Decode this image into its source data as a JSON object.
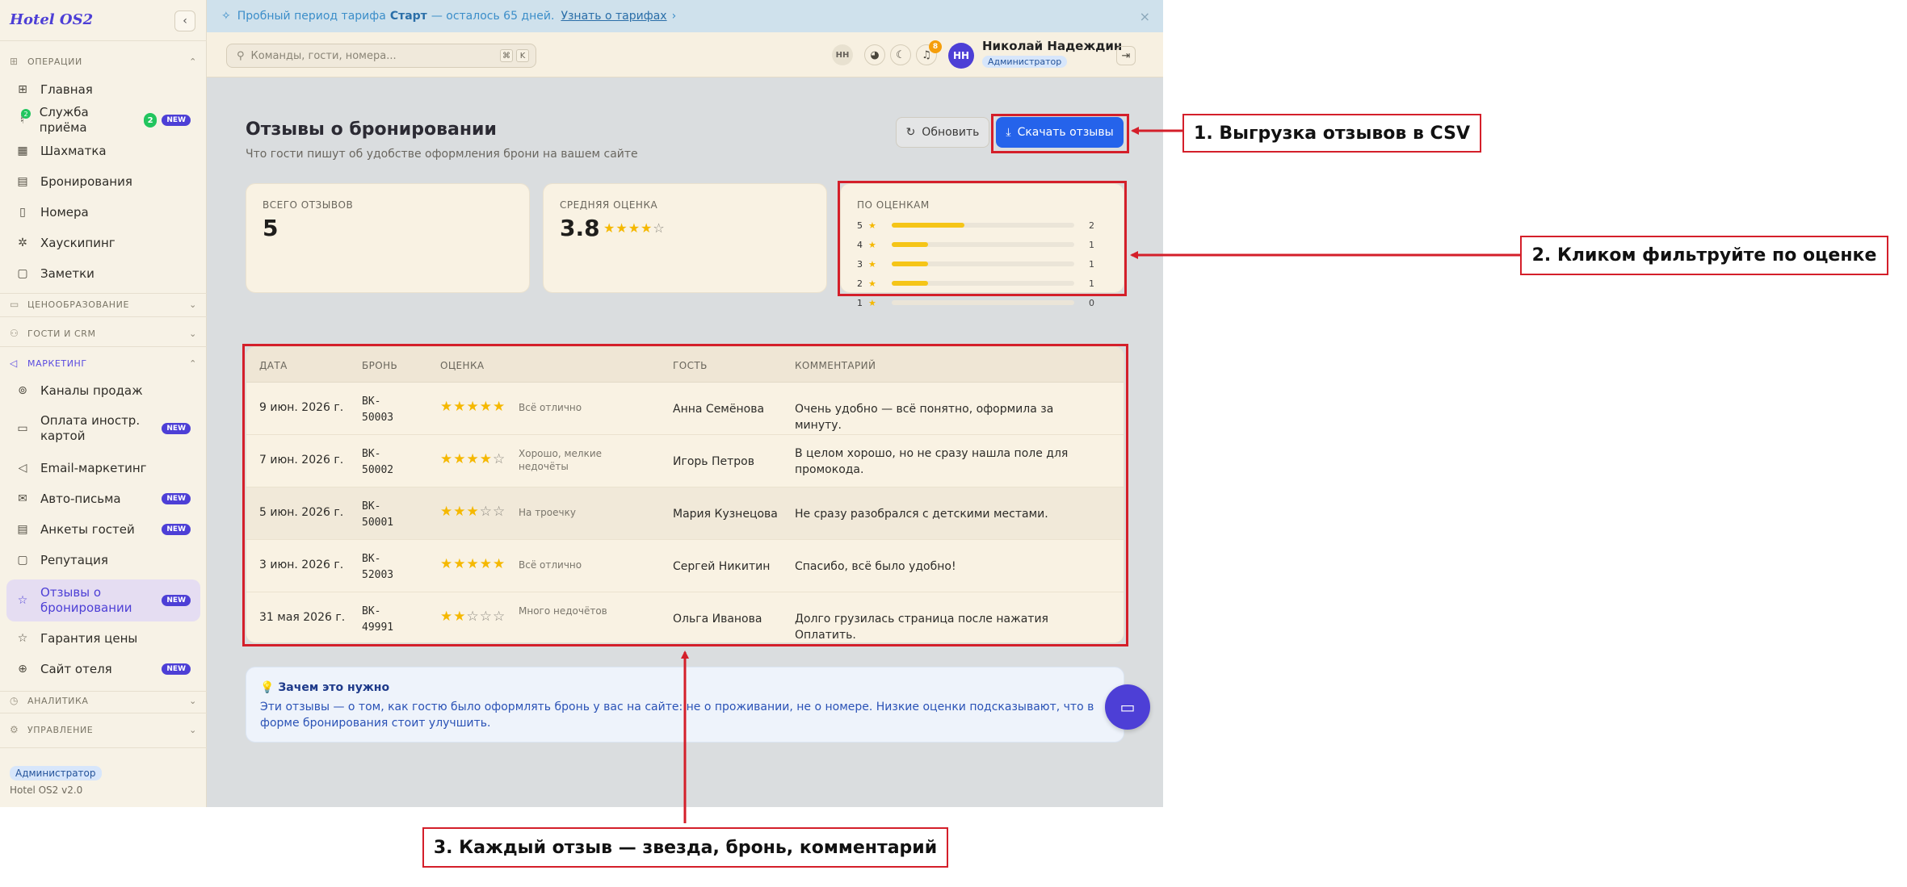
{
  "app": {
    "brand": "Hotel OS2",
    "version": "Hotel OS2 v2.0",
    "role_badge": "Администратор"
  },
  "banner": {
    "text_before": "Пробный период тарифа",
    "plan": "Старт",
    "text_after": "— осталось 65 дней.",
    "link": "Узнать о тарифах"
  },
  "sidebar": {
    "sections": [
      {
        "label": "Операции",
        "expanded": true
      },
      {
        "label": "Ценообразование",
        "expanded": false
      },
      {
        "label": "Гости и CRM",
        "expanded": false
      },
      {
        "label": "Маркетинг",
        "expanded": true
      },
      {
        "label": "Аналитика",
        "expanded": false
      },
      {
        "label": "Управление",
        "expanded": false
      }
    ],
    "operations": [
      {
        "label": "Главная",
        "icon": "grid-icon"
      },
      {
        "label": "Служба приёма",
        "icon": "concierge-bell-icon",
        "count": "2",
        "badge": "NEW",
        "icon_badge": "2"
      },
      {
        "label": "Шахматка",
        "icon": "table-grid-icon"
      },
      {
        "label": "Бронирования",
        "icon": "clipboard-icon"
      },
      {
        "label": "Номера",
        "icon": "door-icon"
      },
      {
        "label": "Хаускипинг",
        "icon": "sparkles-icon"
      },
      {
        "label": "Заметки",
        "icon": "note-icon"
      }
    ],
    "marketing": [
      {
        "label": "Каналы продаж",
        "icon": "broadcast-icon"
      },
      {
        "label": "Оплата иностр. картой",
        "icon": "credit-card-icon",
        "badge": "NEW"
      },
      {
        "label": "Email-маркетинг",
        "icon": "megaphone-icon"
      },
      {
        "label": "Авто-письма",
        "icon": "mail-icon",
        "badge": "NEW"
      },
      {
        "label": "Анкеты гостей",
        "icon": "clipboard-icon",
        "badge": "NEW"
      },
      {
        "label": "Репутация",
        "icon": "message-icon"
      },
      {
        "label": "Отзывы о бронировании",
        "icon": "star-icon",
        "badge": "NEW",
        "active": true
      },
      {
        "label": "Гарантия цены",
        "icon": "star-icon"
      },
      {
        "label": "Сайт отеля",
        "icon": "globe-icon",
        "badge": "NEW"
      }
    ]
  },
  "topbar": {
    "search_placeholder": "Команды, гости, номера...",
    "kbd_1": "⌘",
    "kbd_2": "K",
    "initials_small": "НН",
    "notifications": "8",
    "avatar_initials": "НН",
    "user_name": "Николай Надеждин",
    "user_role": "Администратор"
  },
  "main": {
    "title": "Отзывы о бронировании",
    "subtitle": "Что гости пишут об удобстве оформления брони на вашем сайте",
    "refresh_label": "Обновить",
    "download_label": "Скачать отзывы",
    "total_label": "Всего отзывов",
    "total_value": "5",
    "avg_label": "Средняя оценка",
    "avg_value": "3.8",
    "avg_rating": 3.8,
    "dist_label": "По оценкам",
    "distribution": [
      {
        "stars": "5",
        "count": "2",
        "share": 0.4
      },
      {
        "stars": "4",
        "count": "1",
        "share": 0.2
      },
      {
        "stars": "3",
        "count": "1",
        "share": 0.2
      },
      {
        "stars": "2",
        "count": "1",
        "share": 0.2
      },
      {
        "stars": "1",
        "count": "0",
        "share": 0
      }
    ]
  },
  "table": {
    "columns": [
      "Дата",
      "Бронь",
      "Оценка",
      "Гость",
      "Комментарий"
    ],
    "rows": [
      {
        "date": "9 июн. 2026 г.",
        "booking": "BK-\n50003",
        "rating": 5,
        "rating_note": "Всё отлично",
        "guest": "Анна Семёнова",
        "comment": "Очень удобно — всё понятно, оформила за минуту."
      },
      {
        "date": "7 июн. 2026 г.",
        "booking": "BK-\n50002",
        "rating": 4,
        "rating_note": "Хорошо, мелкие недочёты",
        "guest": "Игорь Петров",
        "comment": "В целом хорошо, но не сразу нашла поле для промокода."
      },
      {
        "date": "5 июн. 2026 г.",
        "booking": "BK-\n50001",
        "rating": 3,
        "rating_note": "На троечку",
        "guest": "Мария Кузнецова",
        "comment": "Не сразу разобрался с детскими местами."
      },
      {
        "date": "3 июн. 2026 г.",
        "booking": "BK-\n52003",
        "rating": 5,
        "rating_note": "Всё отлично",
        "guest": "Сергей Никитин",
        "comment": "Спасибо, всё было удобно!"
      },
      {
        "date": "31 мая 2026 г.",
        "booking": "BK-\n49991",
        "rating": 2,
        "rating_note": "Много недочётов",
        "guest": "Ольга Иванова",
        "comment": "Долго грузилась страница после нажатия Оплатить."
      }
    ]
  },
  "info": {
    "title": "Зачем это нужно",
    "text": "Эти отзывы — о том, как гостю было оформлять бронь у вас на сайте: не о проживании, не о номере. Низкие оценки подсказывают, что в форме бронирования стоит улучшить."
  },
  "annotations": {
    "callout_1": "1. Выгрузка отзывов в CSV",
    "callout_2": "2. Кликом фильтруйте по оценке",
    "callout_3": "3. Каждый отзыв — звезда, бронь, комментарий",
    "color": "#d41f2a"
  },
  "colors": {
    "accent": "#4d3fd6",
    "primary_button": "#2563eb",
    "star": "#f5b800",
    "new_badge": "#4d3fd6"
  }
}
